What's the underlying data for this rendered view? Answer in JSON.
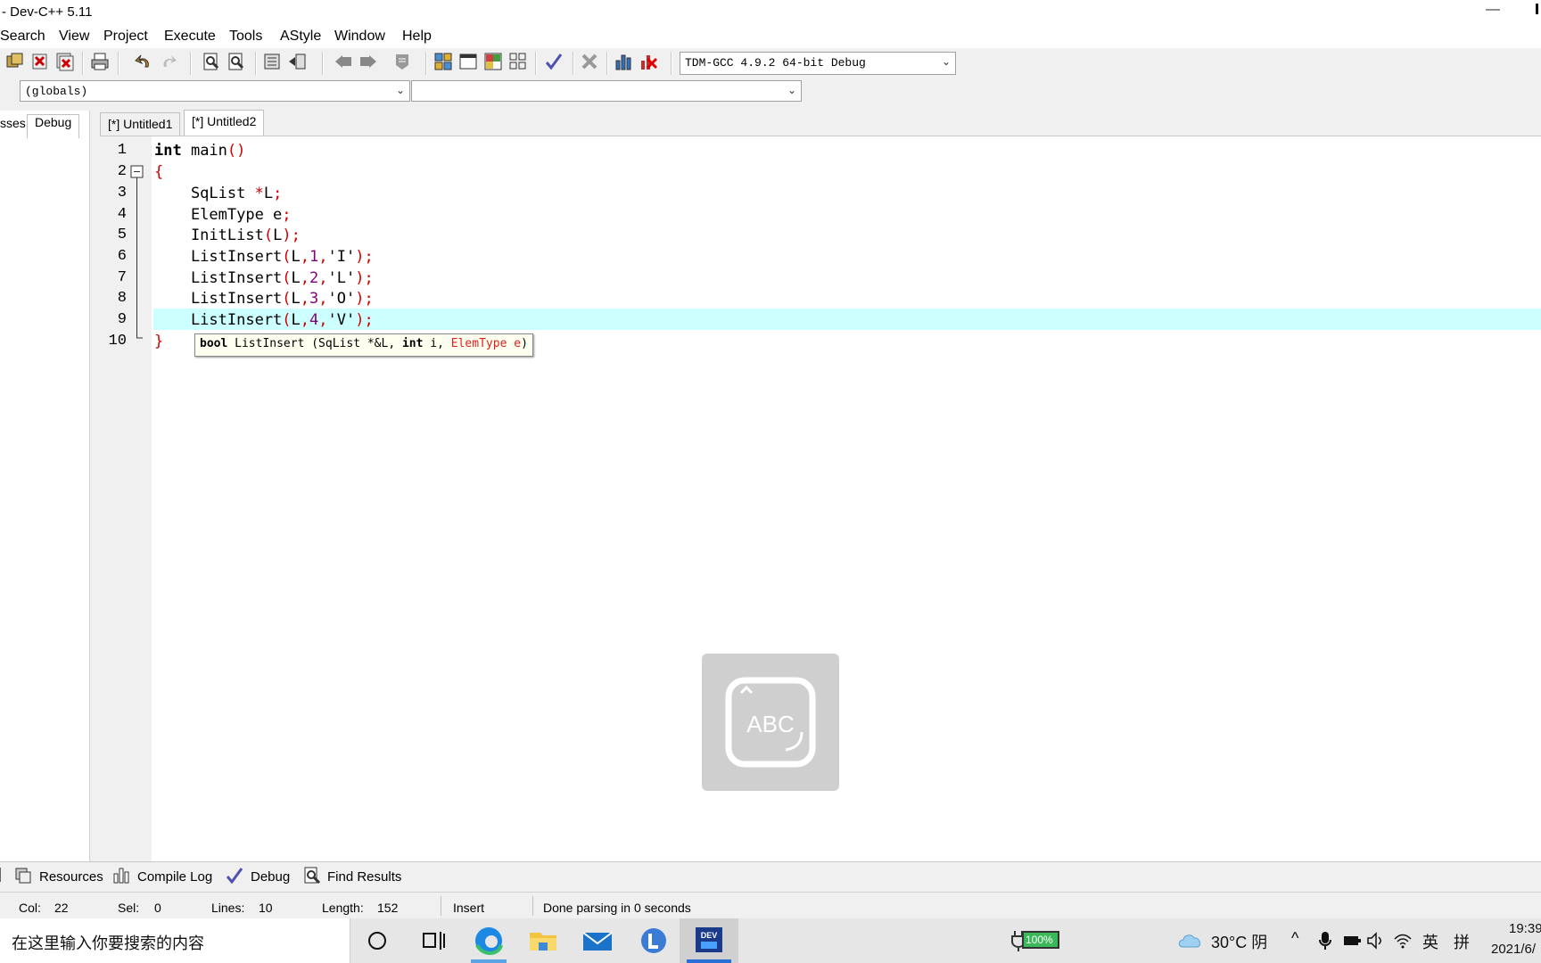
{
  "window": {
    "title": "- Dev-C++ 5.11"
  },
  "menu": [
    "Search",
    "View",
    "Project",
    "Execute",
    "Tools",
    "AStyle",
    "Window",
    "Help"
  ],
  "toolbar": {
    "compiler": "TDM-GCC 4.9.2 64-bit Debug"
  },
  "toolbar2": {
    "scope": "(globals)",
    "member": ""
  },
  "left_tabs": [
    "sses",
    "Debug"
  ],
  "editor_tabs": [
    "[*] Untitled1",
    "[*] Untitled2"
  ],
  "code": {
    "line_numbers": [
      "1",
      "2",
      "3",
      "4",
      "5",
      "6",
      "7",
      "8",
      "9",
      "10"
    ],
    "current_line": 9
  },
  "tooltip": {
    "text": "bool ListInsert (SqList *&L, int i, ElemType e)",
    "highlight": "ElemType e"
  },
  "ime": {
    "label": "ABC"
  },
  "bottom_tabs": [
    "Resources",
    "Compile Log",
    "Debug",
    "Find Results"
  ],
  "status": {
    "col_label": "Col:",
    "col": "22",
    "sel_label": "Sel:",
    "sel": "0",
    "lines_label": "Lines:",
    "lines": "10",
    "length_label": "Length:",
    "length": "152",
    "mode": "Insert",
    "message": "Done parsing in 0 seconds"
  },
  "taskbar": {
    "search_placeholder": "在这里输入你要搜索的内容",
    "battery": "100%",
    "weather": "30°C 阴",
    "lang1": "英",
    "lang2": "拼",
    "time": "19:39",
    "date": "2021/6/"
  },
  "colors": {
    "current_line": "#ccffff",
    "symbol": "#d00000",
    "number": "#800080"
  }
}
